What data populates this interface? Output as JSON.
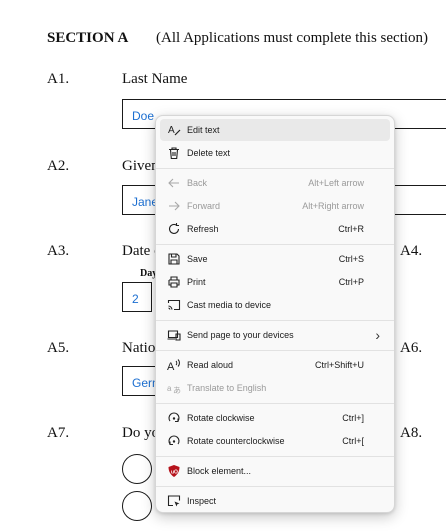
{
  "form": {
    "section_title": "SECTION A",
    "section_note": "(All Applications must complete this section)",
    "a1": {
      "num": "A1.",
      "label": "Last Name",
      "value": "Doe"
    },
    "a2": {
      "num": "A2.",
      "label": "Given",
      "value": "Jane"
    },
    "a3": {
      "num": "A3.",
      "label": "Date c",
      "day_label": "Day",
      "day_value": "2"
    },
    "a4": {
      "num": "A4."
    },
    "a5": {
      "num": "A5.",
      "label": "Nation",
      "value": "Germ"
    },
    "a6": {
      "num": "A6."
    },
    "a7": {
      "num": "A7.",
      "label": "Do yo"
    },
    "a8": {
      "num": "A8."
    }
  },
  "context_menu": {
    "items": [
      {
        "label": "Edit text",
        "shortcut": "",
        "icon": "edit-text-icon",
        "disabled": false,
        "highlighted": true
      },
      {
        "label": "Delete text",
        "shortcut": "",
        "icon": "trash-icon",
        "disabled": false
      },
      {
        "label": "Back",
        "shortcut": "Alt+Left arrow",
        "icon": "back-arrow-icon",
        "disabled": true
      },
      {
        "label": "Forward",
        "shortcut": "Alt+Right arrow",
        "icon": "forward-arrow-icon",
        "disabled": true
      },
      {
        "label": "Refresh",
        "shortcut": "Ctrl+R",
        "icon": "refresh-icon",
        "disabled": false
      },
      {
        "label": "Save",
        "shortcut": "Ctrl+S",
        "icon": "save-icon",
        "disabled": false
      },
      {
        "label": "Print",
        "shortcut": "Ctrl+P",
        "icon": "print-icon",
        "disabled": false
      },
      {
        "label": "Cast media to device",
        "shortcut": "",
        "icon": "cast-icon",
        "disabled": false
      },
      {
        "label": "Send page to your devices",
        "shortcut": "",
        "icon": "send-to-devices-icon",
        "disabled": false,
        "submenu": true
      },
      {
        "label": "Read aloud",
        "shortcut": "Ctrl+Shift+U",
        "icon": "read-aloud-icon",
        "disabled": false
      },
      {
        "label": "Translate to English",
        "shortcut": "",
        "icon": "translate-icon",
        "disabled": true
      },
      {
        "label": "Rotate clockwise",
        "shortcut": "Ctrl+]",
        "icon": "rotate-clockwise-icon",
        "disabled": false
      },
      {
        "label": "Rotate counterclockwise",
        "shortcut": "Ctrl+[",
        "icon": "rotate-counterclockwise-icon",
        "disabled": false
      },
      {
        "label": "Block element...",
        "shortcut": "",
        "icon": "ublock-shield-icon",
        "disabled": false
      },
      {
        "label": "Inspect",
        "shortcut": "",
        "icon": "inspect-icon",
        "disabled": false
      }
    ]
  },
  "colors": {
    "field_text": "#1c6fd1",
    "menu_bg": "#f9f9f9",
    "menu_highlight": "#e9e9e9",
    "disabled_text": "#9a9a9a",
    "ublock_red": "#b5121b"
  }
}
